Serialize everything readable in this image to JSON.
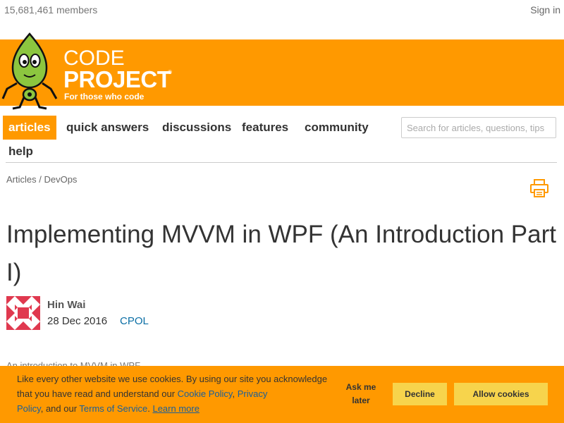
{
  "header": {
    "members": "15,681,461 members",
    "signin": "Sign in"
  },
  "logo": {
    "code": "CODE",
    "project": "PROJECT",
    "registered": "®",
    "tagline": "For those who code"
  },
  "nav": {
    "items": [
      {
        "label": "articles",
        "active": true
      },
      {
        "label": "quick answers"
      },
      {
        "label": "discussions"
      },
      {
        "label": "features"
      },
      {
        "label": "community"
      },
      {
        "label": "help"
      }
    ],
    "search_placeholder": "Search for articles, questions, tips"
  },
  "breadcrumb": {
    "articles": "Articles",
    "separator": " / ",
    "section": "DevOps"
  },
  "article": {
    "title": "Implementing MVVM in WPF (An Introduction Part I)",
    "author": "Hin Wai",
    "date": "28 Dec 2016",
    "license": "CPOL",
    "summary": "An introduction to MVVM in WPF"
  },
  "cookie": {
    "text_prefix": "Like every other website we use cookies. By using our site you acknowledge that you have read and understand our ",
    "cookie_policy": "Cookie Policy",
    "sep1": ", ",
    "privacy_policy": "Privacy Policy",
    "sep2": ", and our ",
    "terms": "Terms of Service",
    "sep3": ". ",
    "learn_more": "Learn more",
    "ask_me_later": "Ask me later",
    "decline": "Decline",
    "allow": "Allow cookies"
  },
  "colors": {
    "brand_orange": "#ff9900",
    "button_yellow": "#f7d44c",
    "link_blue": "#0a6ea5",
    "avatar_red": "#e0394f"
  }
}
